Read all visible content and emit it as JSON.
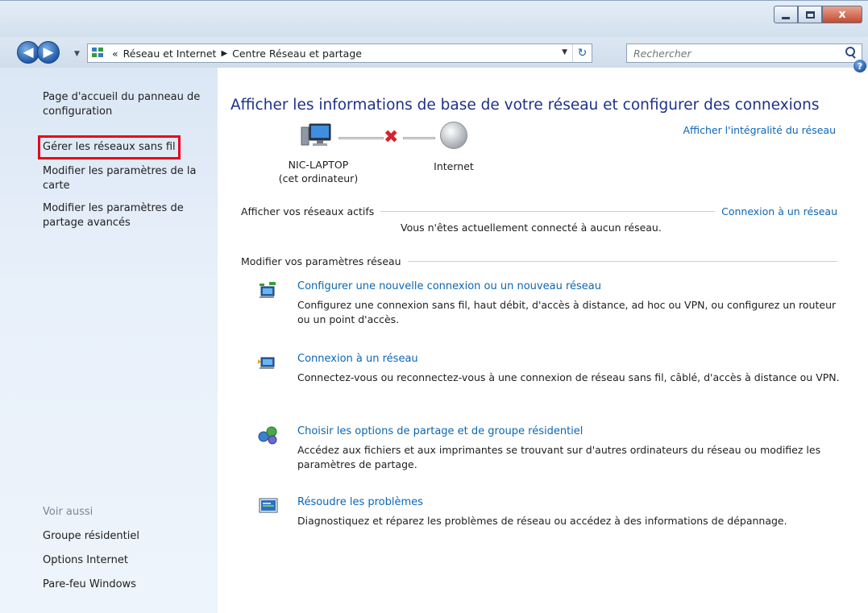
{
  "window": {
    "min_glyph": "minimize",
    "max_glyph": "maximize",
    "close_glyph": "x"
  },
  "nav": {
    "back_icon": "◀",
    "forward_icon": "▶",
    "breadcrumb": {
      "overflow": "«",
      "part1": "Réseau et Internet",
      "separator": "▶",
      "part2": "Centre Réseau et partage"
    },
    "refresh_icon": "↻",
    "search_placeholder": "Rechercher"
  },
  "sidebar": {
    "home_link": "Page d'accueil du panneau de configuration",
    "links": [
      "Gérer les réseaux sans fil",
      "Modifier les paramètres de la carte",
      "Modifier les paramètres de partage avancés"
    ],
    "see_also_header": "Voir aussi",
    "see_also": [
      "Groupe résidentiel",
      "Options Internet",
      "Pare-feu Windows"
    ]
  },
  "main": {
    "help_icon": "?",
    "title": "Afficher les informations de base de votre réseau et configurer des connexions",
    "full_map_link": "Afficher l'intégralité du réseau",
    "computer_name": "NIC-LAPTOP",
    "computer_sub": "(cet ordinateur)",
    "internet_label": "Internet",
    "active_networks_label": "Afficher vos réseaux actifs",
    "connect_link": "Connexion à un réseau",
    "not_connected_text": "Vous n'êtes actuellement connecté à aucun réseau.",
    "change_settings_label": "Modifier vos paramètres réseau",
    "tasks": [
      {
        "title": "Configurer une nouvelle connexion ou un nouveau réseau",
        "desc": "Configurez une connexion sans fil, haut débit, d'accès à distance, ad hoc ou VPN, ou configurez un routeur ou un point d'accès."
      },
      {
        "title": "Connexion à un réseau",
        "desc": "Connectez-vous ou reconnectez-vous à une connexion de réseau sans fil, câblé, d'accès à distance ou VPN."
      },
      {
        "title": "Choisir les options de partage et de groupe résidentiel",
        "desc": "Accédez aux fichiers et aux imprimantes se trouvant sur d'autres ordinateurs du réseau ou modifiez les paramètres de partage."
      },
      {
        "title": "Résoudre les problèmes",
        "desc": "Diagnostiquez et réparez les problèmes de réseau ou accédez à des informations de dépannage."
      }
    ]
  }
}
